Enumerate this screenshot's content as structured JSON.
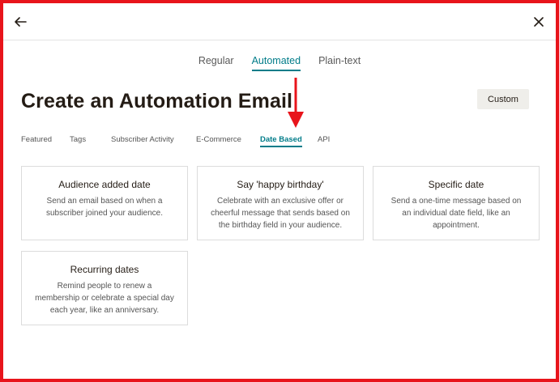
{
  "mode_tabs": [
    {
      "label": "Regular",
      "active": false
    },
    {
      "label": "Automated",
      "active": true
    },
    {
      "label": "Plain-text",
      "active": false
    }
  ],
  "page_title": "Create an Automation Email",
  "custom_button": "Custom",
  "category_tabs": [
    {
      "label": "Featured",
      "active": false
    },
    {
      "label": "Tags",
      "active": false
    },
    {
      "label": "Subscriber Activity",
      "active": false
    },
    {
      "label": "E-Commerce",
      "active": false
    },
    {
      "label": "Date Based",
      "active": true
    },
    {
      "label": "API",
      "active": false
    }
  ],
  "cards": [
    {
      "title": "Audience added date",
      "description": "Send an email based on when a subscriber joined your audience."
    },
    {
      "title": "Say 'happy birthday'",
      "description": "Celebrate with an exclusive offer or cheerful message that sends based on the birthday field in your audience."
    },
    {
      "title": "Specific date",
      "description": "Send a one-time message based on an individual date field, like an appointment."
    },
    {
      "title": "Recurring dates",
      "description": "Remind people to renew a membership or celebrate a special day each year, like an anniversary."
    }
  ],
  "icons": {
    "back": "arrow-left-icon",
    "close": "close-icon",
    "annotation": "red-down-arrow"
  },
  "colors": {
    "accent": "#007c89",
    "annotation": "#e8141b",
    "title": "#241c15",
    "button_bg": "#efeeea"
  }
}
